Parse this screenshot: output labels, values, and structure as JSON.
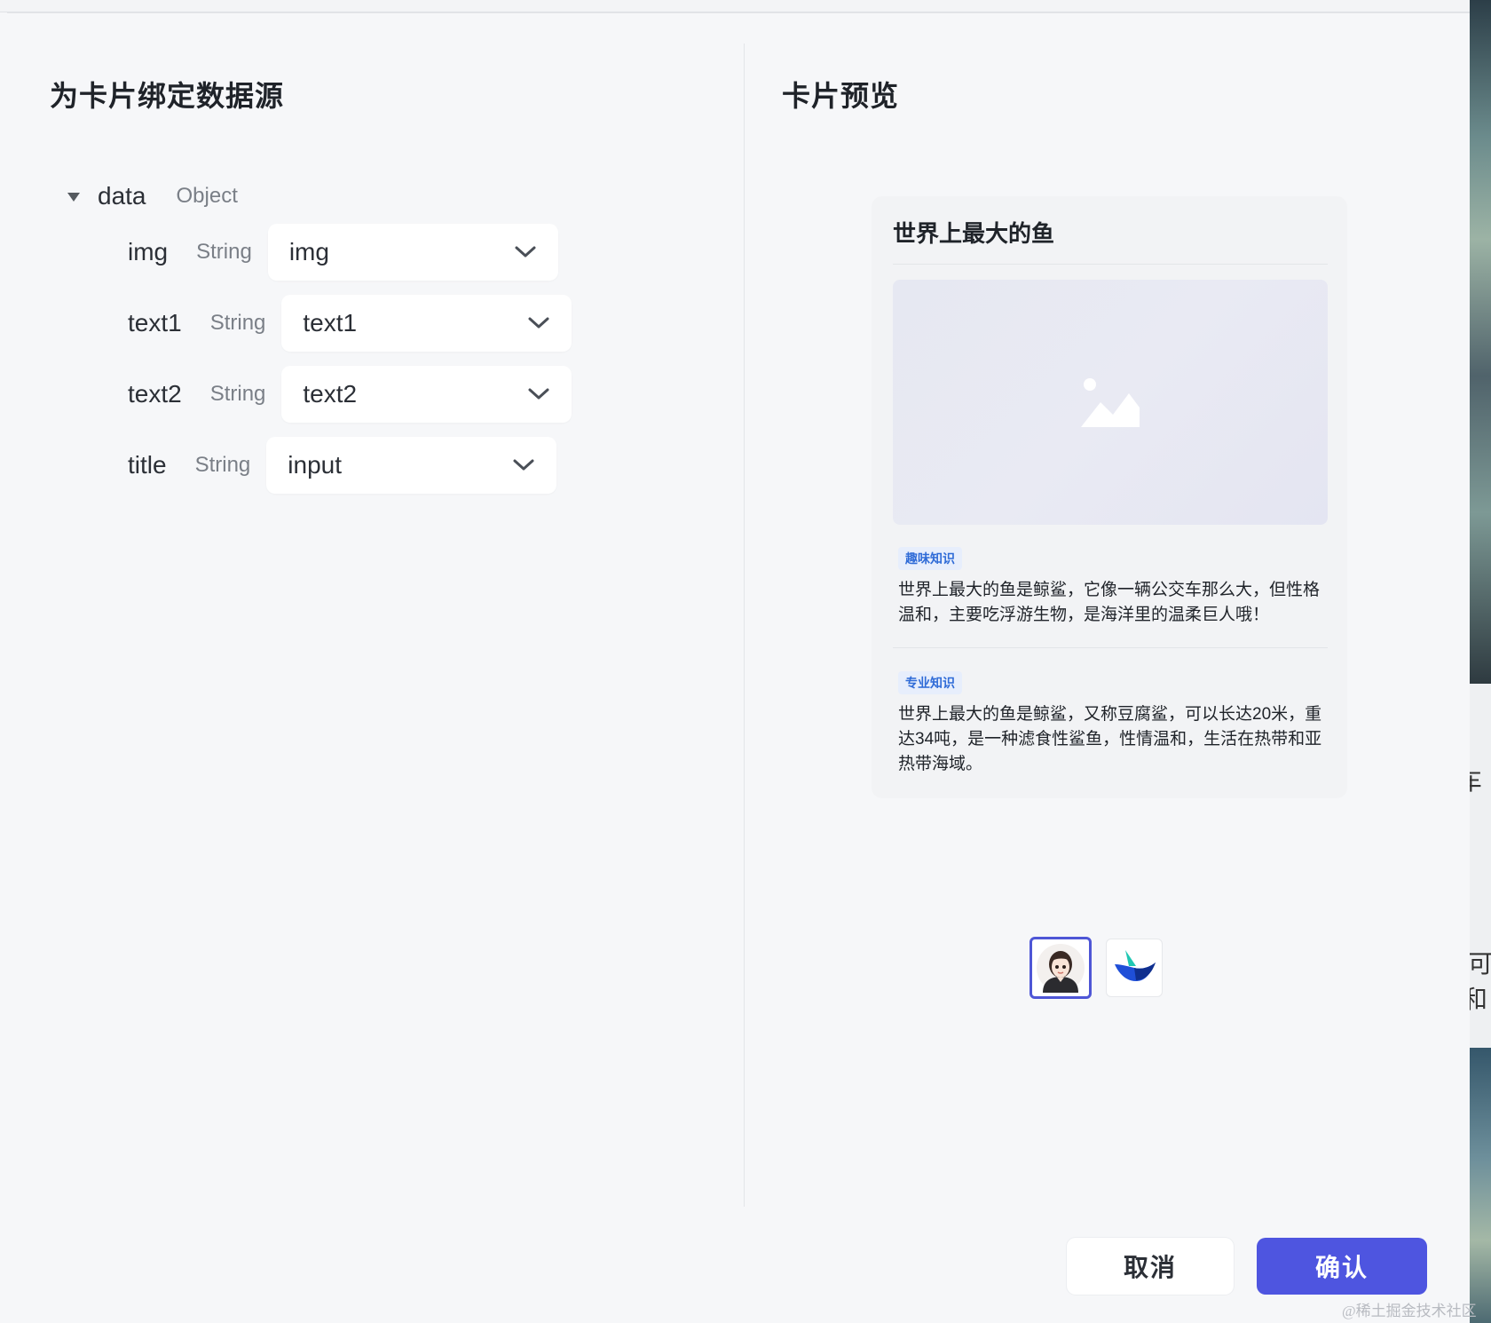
{
  "left_panel": {
    "title": "为卡片绑定数据源",
    "root": {
      "name": "data",
      "type": "Object"
    },
    "fields": [
      {
        "name": "img",
        "type": "String",
        "value": "img"
      },
      {
        "name": "text1",
        "type": "String",
        "value": "text1"
      },
      {
        "name": "text2",
        "type": "String",
        "value": "text2"
      },
      {
        "name": "title",
        "type": "String",
        "value": "input"
      }
    ]
  },
  "right_panel": {
    "title": "卡片预览",
    "card": {
      "title": "世界上最大的鱼",
      "image_icon": "image-placeholder-icon",
      "sections": [
        {
          "tag": "趣味知识",
          "text": "世界上最大的鱼是鲸鲨，它像一辆公交车那么大，但性格温和，主要吃浮游生物，是海洋里的温柔巨人哦！"
        },
        {
          "tag": "专业知识",
          "text": "世界上最大的鱼是鲸鲨，又称豆腐鲨，可以长达20米，重达34吨，是一种滤食性鲨鱼，性情温和，生活在热带和亚热带海域。"
        }
      ]
    },
    "avatars": [
      {
        "icon": "girl-avatar-icon",
        "selected": true
      },
      {
        "icon": "bird-logo-icon",
        "selected": false
      }
    ]
  },
  "footer": {
    "cancel_label": "取消",
    "confirm_label": "确认"
  },
  "background": {
    "fragment_1": "车",
    "fragment_2": "可",
    "fragment_3": "和"
  },
  "watermark": "@稀土掘金技术社区",
  "colors": {
    "primary": "#4e55e0",
    "tag_bg": "#e7eefc",
    "tag_text": "#2f6bd7"
  }
}
